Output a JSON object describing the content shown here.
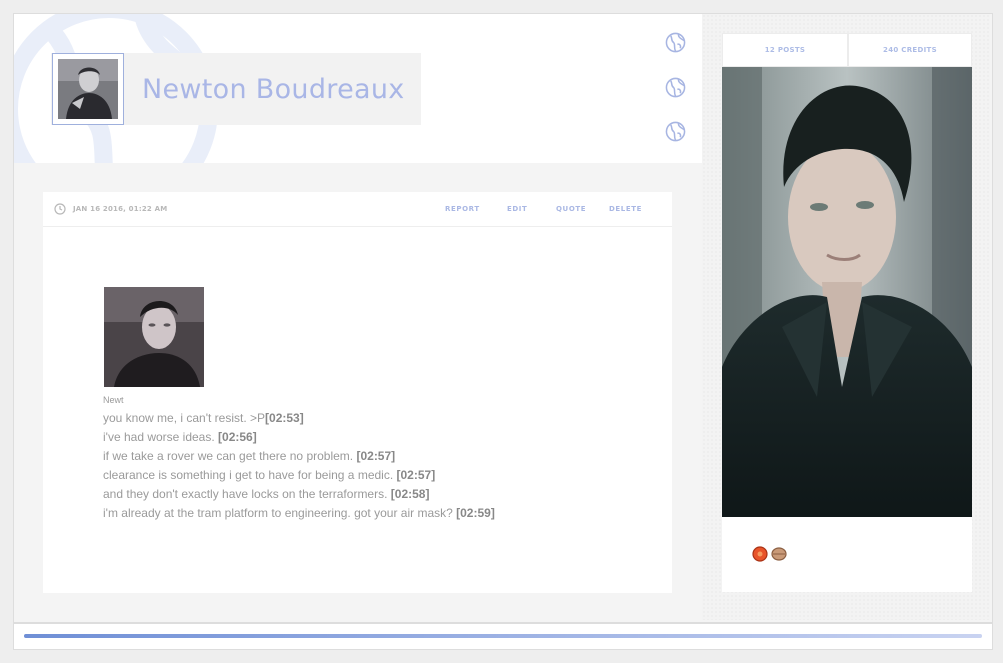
{
  "profile": {
    "name": "Newton Boudreaux",
    "icons": [
      "globe-icon",
      "globe-icon",
      "globe-icon"
    ]
  },
  "stats": {
    "posts": "12 POSTS",
    "credits": "240 CREDITS"
  },
  "post": {
    "date": "JAN 16 2016, 01:22 AM",
    "actions": [
      "REPORT",
      "EDIT",
      "QUOTE",
      "DELETE"
    ],
    "caption": "Newt",
    "lines": [
      {
        "text": "you know me, i can't resist. >P",
        "time": "[02:53]"
      },
      {
        "text": "i've had worse ideas. ",
        "time": "[02:56]"
      },
      {
        "text": "if we take a rover we can get there no problem. ",
        "time": "[02:57]"
      },
      {
        "text": "clearance is something i get to have for being a medic. ",
        "time": "[02:57]"
      },
      {
        "text": "and they don't exactly have locks on the terraformers. ",
        "time": "[02:58]"
      },
      {
        "text": "i'm already at the tram platform to engineering. got your air mask? ",
        "time": "[02:59]"
      }
    ]
  },
  "badges": [
    "orange-badge-icon",
    "tan-badge-icon"
  ],
  "colors": {
    "accent": "#a9b6e6",
    "progress_start": "#6f8fd6",
    "progress_end": "#c9d3f1"
  },
  "footer": {
    "progress": 1.0
  }
}
